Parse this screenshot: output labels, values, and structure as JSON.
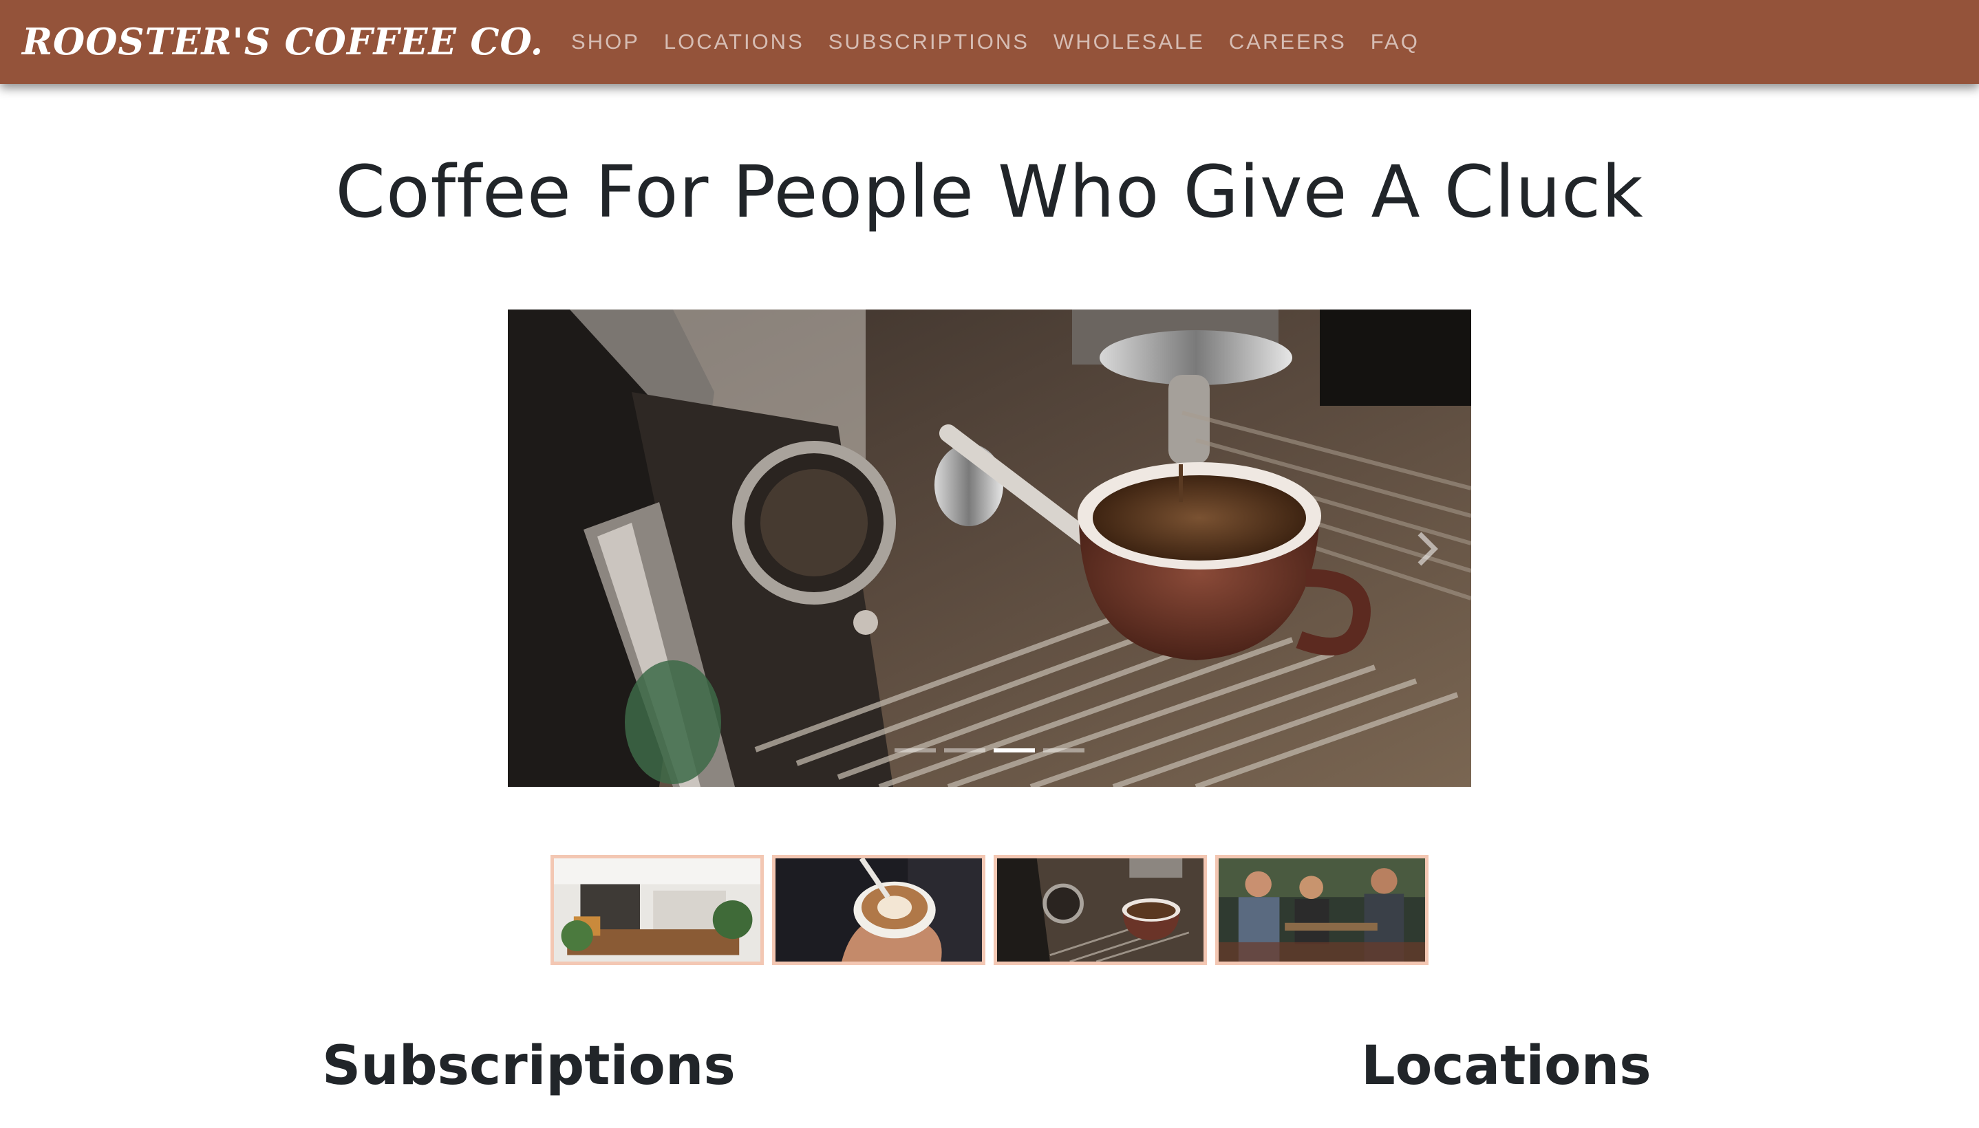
{
  "navbar": {
    "brand": "ROOSTER'S COFFEE CO.",
    "links": [
      "SHOP",
      "LOCATIONS",
      "SUBSCRIPTIONS",
      "WHOLESALE",
      "CAREERS",
      "FAQ"
    ],
    "background_color": "#94533a"
  },
  "hero": {
    "headline": "Coffee For People Who Give A Cluck"
  },
  "carousel": {
    "slide_count": 4,
    "active_index": 2,
    "next_icon": "chevron-right-icon"
  },
  "thumbnails": {
    "border_color": "#f3c7b3"
  },
  "sections": {
    "subscriptions_title": "Subscriptions",
    "locations_title": "Locations"
  }
}
